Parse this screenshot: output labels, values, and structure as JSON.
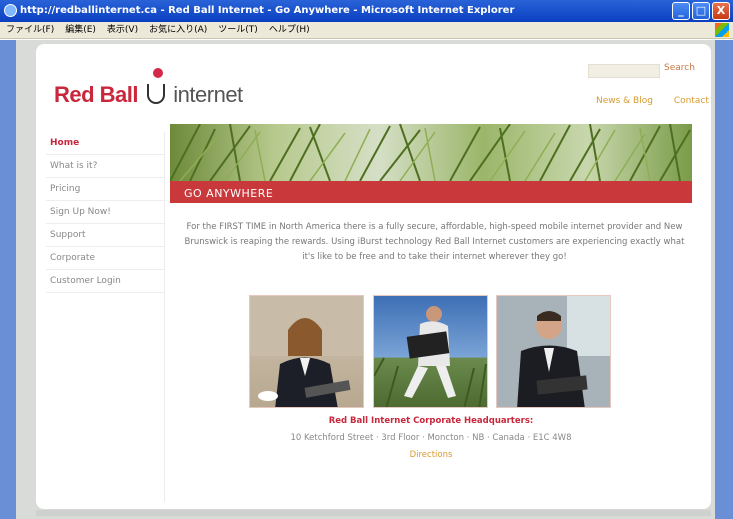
{
  "window": {
    "title": "http://redballinternet.ca - Red Ball Internet - Go Anywhere - Microsoft Internet Explorer",
    "minimize": "_",
    "maximize": "□",
    "close": "X"
  },
  "menubar": {
    "items": [
      "ファイル(F)",
      "編集(E)",
      "表示(V)",
      "お気に入り(A)",
      "ツール(T)",
      "ヘルプ(H)"
    ]
  },
  "header": {
    "logo_red": "Red Ball",
    "logo_gray": "internet",
    "search_label": "Search",
    "links": [
      "News & Blog",
      "Contact Us"
    ]
  },
  "nav": {
    "items": [
      "Home",
      "What is it?",
      "Pricing",
      "Sign Up Now!",
      "Support",
      "Corporate",
      "Customer Login"
    ]
  },
  "banner": {
    "title": "GO ANYWHERE"
  },
  "intro": {
    "text": "For the FIRST TIME in North America there is a fully secure, affordable, high-speed mobile internet provider and New Brunswick is reaping the rewards. Using iBurst technology Red Ball Internet customers are experiencing exactly what it's like to be free and to take their internet wherever they go!"
  },
  "hq": {
    "title": "Red Ball Internet Corporate Headquarters:",
    "address": "10 Ketchford Street · 3rd Floor · Moncton · NB · Canada · E1C 4W8",
    "link": "Directions"
  },
  "colors": {
    "brand_red": "#c9283c",
    "accent_orange": "#d89a30",
    "titlebar_blue": "#0a3fc0"
  }
}
